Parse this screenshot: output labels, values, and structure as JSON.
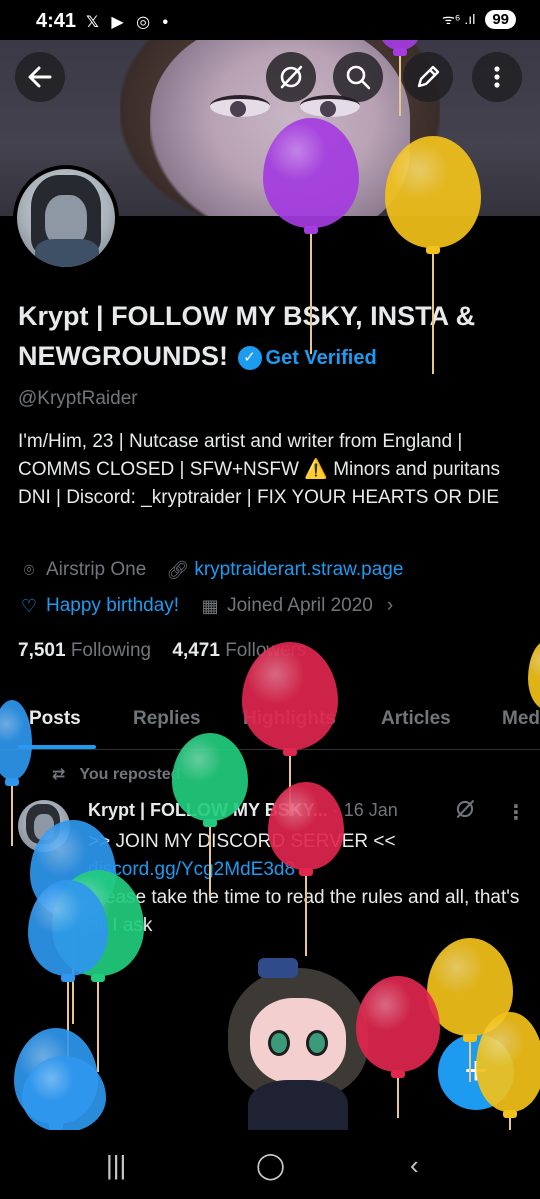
{
  "status_bar": {
    "time": "4:41",
    "notification_icons": "𝕏 ▶ ◎ •",
    "signal": "ᯤ⁶ .ıl",
    "battery": "99"
  },
  "header_buttons": {
    "back": "back-arrow-icon",
    "grok": "grok-icon",
    "search": "search-icon",
    "edit": "edit-icon",
    "more": "more-icon"
  },
  "profile": {
    "name": "Krypt | FOLLOW MY BSKY, INSTA & NEWGROUNDS!",
    "get_verified": "Get Verified",
    "handle": "@KryptRaider",
    "bio": "I'm/Him, 23 | Nutcase artist and writer from England | COMMS CLOSED | SFW+NSFW ⚠️ Minors and puritans DNI | Discord: _kryptraider | FIX YOUR HEARTS OR DIE",
    "location": "Airstrip One",
    "website": "kryptraiderart.straw.page",
    "birthday": "Happy birthday!",
    "joined": "Joined April 2020",
    "following_count": "7,501",
    "following_label": "Following",
    "followers_count": "4,471",
    "followers_label": "Followers"
  },
  "tabs": [
    "Posts",
    "Replies",
    "Highlights",
    "Articles",
    "Media"
  ],
  "post": {
    "repost_label": "You reposted",
    "author": "Krypt | FOLLOW MY BSKY...",
    "date": "· 16 Jan",
    "line1": ">> JOIN MY DISCORD SERVER <<",
    "link": "discord.gg/Ycg2MdE3d8",
    "line2": "Please take the time to read the rules and all, that's all I ask"
  },
  "fab_label": "+",
  "colors": {
    "accent": "#1d9bf0",
    "balloon_red": "#e0274f",
    "balloon_yellow": "#f2c21b",
    "balloon_purple": "#a43ce0",
    "balloon_green": "#22cc7e",
    "balloon_blue": "#2f97ee"
  }
}
